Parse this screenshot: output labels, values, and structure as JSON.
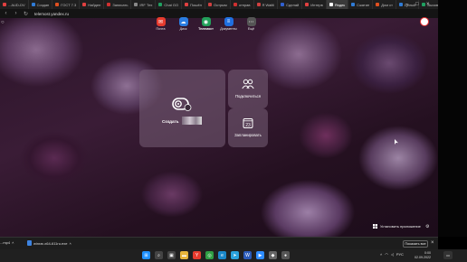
{
  "browser": {
    "tabs": [
      {
        "label": "...AUD-DV",
        "color": "#e04040"
      },
      {
        "label": "Создан",
        "color": "#2f7bd6"
      },
      {
        "label": "ГОСТ 7.3",
        "color": "#e05020"
      },
      {
        "label": "Найден",
        "color": "#e04040"
      },
      {
        "label": "Записать",
        "color": "#d03030"
      },
      {
        "label": "IRF Тех",
        "color": "#888888"
      },
      {
        "label": "Chat GO",
        "color": "#20a060"
      },
      {
        "label": "Пошёл",
        "color": "#e04040"
      },
      {
        "label": "Острым",
        "color": "#d04040"
      },
      {
        "label": "отправ",
        "color": "#d03030"
      },
      {
        "label": "Я Waitli",
        "color": "#d04040"
      },
      {
        "label": "Сделай",
        "color": "#3060d0"
      },
      {
        "label": "Интерв",
        "color": "#e04040"
      },
      {
        "label": "Яндек",
        "color": "#ffffff",
        "active": true
      },
      {
        "label": "Сжатие",
        "color": "#2f7bd6"
      },
      {
        "label": "Дом ст",
        "color": "#e05020"
      },
      {
        "label": "Целый",
        "color": "#2f7bd6"
      },
      {
        "label": "Вызов",
        "color": "#20a060"
      },
      {
        "label": "Д Генера",
        "color": "#2f7bd6"
      }
    ],
    "new_tab": "+",
    "url": "telemost.yandex.ru",
    "back": "‹",
    "forward": "›",
    "reload": "↻"
  },
  "apps": [
    {
      "name": "mail",
      "label": "Почта",
      "color": "#e63b2e",
      "glyph": "✉"
    },
    {
      "name": "disk",
      "label": "Диск",
      "color": "#2a7de1",
      "glyph": "☁"
    },
    {
      "name": "telemost",
      "label": "Телемост",
      "color": "#22a05a",
      "glyph": "◉",
      "active": true
    },
    {
      "name": "documents",
      "label": "Документы",
      "color": "#1f6fe0",
      "glyph": "≡"
    },
    {
      "name": "more",
      "label": "Ещё",
      "color": "#555555",
      "glyph": "⋯"
    }
  ],
  "main": {
    "create_label": "Создать",
    "join_label": "Подключиться",
    "schedule_label": "Запланировать",
    "schedule_day": "23"
  },
  "install": {
    "label": "Установить приложение"
  },
  "downloads": {
    "items": [
      "...mp4",
      "winrar-x64-611ru.exe"
    ],
    "show_all": "Показать все",
    "close": "×"
  },
  "taskbar": {
    "icons": [
      {
        "name": "start",
        "color": "#1e90ff",
        "glyph": "⊞"
      },
      {
        "name": "search",
        "color": "#444444",
        "glyph": "⌕"
      },
      {
        "name": "task-view",
        "color": "#444444",
        "glyph": "▣"
      },
      {
        "name": "explorer",
        "color": "#e7b53b",
        "glyph": "▬"
      },
      {
        "name": "yandex-browser",
        "color": "#e63b2e",
        "glyph": "Y"
      },
      {
        "name": "chrome",
        "color": "#2f9e44",
        "glyph": "◎"
      },
      {
        "name": "edge",
        "color": "#1a87c9",
        "glyph": "e"
      },
      {
        "name": "telegram",
        "color": "#2aa2de",
        "glyph": "➤"
      },
      {
        "name": "word",
        "color": "#2b5bb8",
        "glyph": "W"
      },
      {
        "name": "zoom",
        "color": "#2d8cff",
        "glyph": "▶"
      },
      {
        "name": "app-11",
        "color": "#666666",
        "glyph": "◆"
      },
      {
        "name": "app-12",
        "color": "#555555",
        "glyph": "●"
      }
    ],
    "tray_lang": "РУС",
    "clock_time": "0:00",
    "clock_date": "02.09.2022"
  }
}
